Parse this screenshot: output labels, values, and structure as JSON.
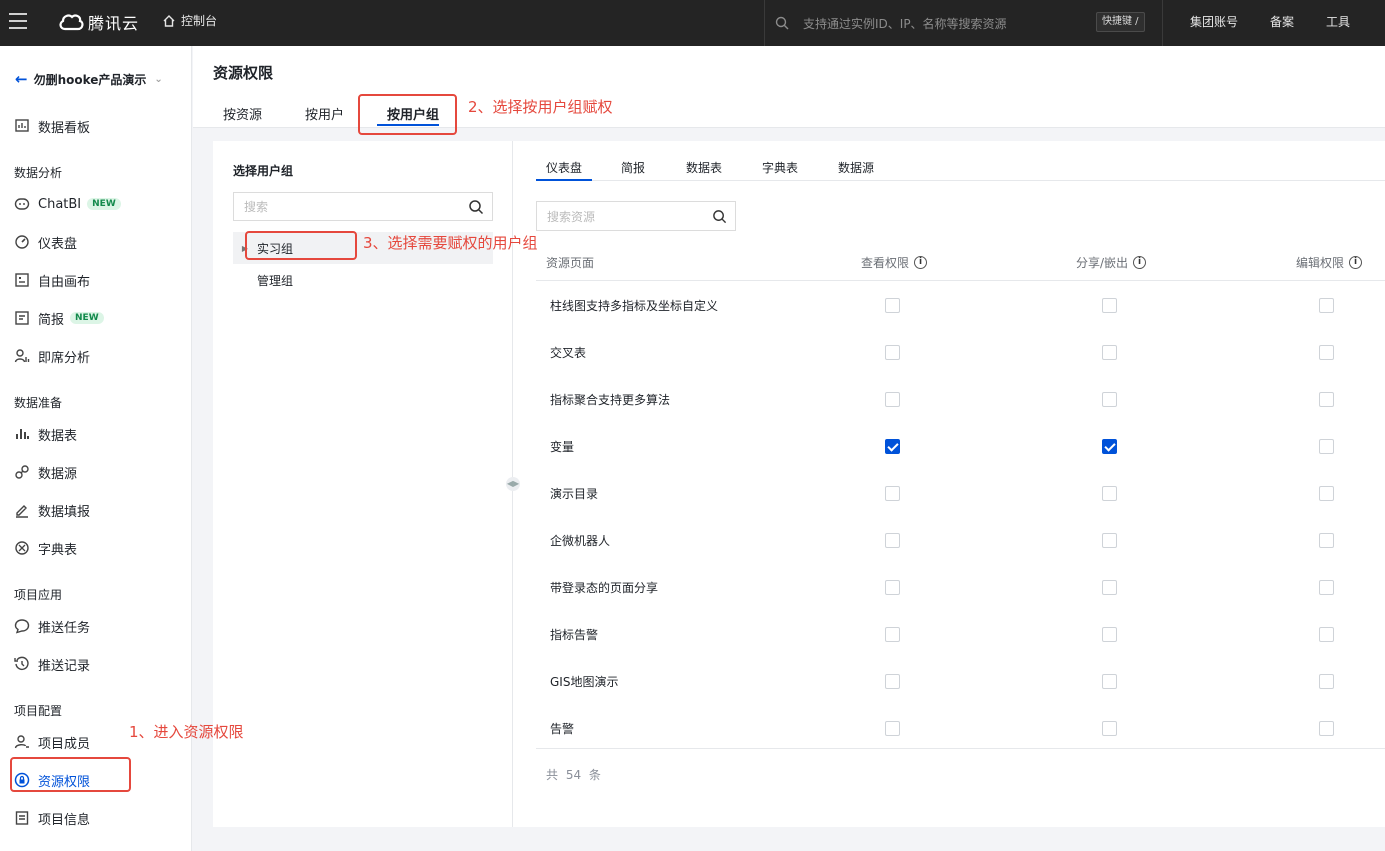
{
  "topbar": {
    "logo_text": "腾讯云",
    "console": "控制台",
    "search_placeholder": "支持通过实例ID、IP、名称等搜索资源",
    "hotkey": "快捷键 /",
    "links": [
      "集团账号",
      "备案",
      "工具"
    ]
  },
  "sidebar": {
    "project": "勿删hooke产品演示",
    "dashboard_board": "数据看板",
    "sections": {
      "analysis": "数据分析",
      "prepare": "数据准备",
      "app": "项目应用",
      "config": "项目配置"
    },
    "items": {
      "chatbi": "ChatBI",
      "dashboard": "仪表盘",
      "canvas": "自由画布",
      "brief": "简报",
      "adhoc": "即席分析",
      "table": "数据表",
      "source": "数据源",
      "fill": "数据填报",
      "dict": "字典表",
      "push_task": "推送任务",
      "push_log": "推送记录",
      "members": "项目成员",
      "permissions": "资源权限",
      "info": "项目信息"
    },
    "badge_new": "NEW"
  },
  "header": {
    "title": "资源权限",
    "tabs": [
      "按资源",
      "按用户",
      "按用户组"
    ]
  },
  "left_pane": {
    "title": "选择用户组",
    "search_placeholder": "搜索",
    "groups": [
      "实习组",
      "管理组"
    ]
  },
  "right_pane": {
    "tabs": [
      "仪表盘",
      "简报",
      "数据表",
      "字典表",
      "数据源"
    ],
    "search_placeholder": "搜索资源",
    "columns": [
      "资源页面",
      "查看权限",
      "分享/嵌出",
      "编辑权限"
    ],
    "rows": [
      {
        "name": "柱线图支持多指标及坐标自定义",
        "view": false,
        "share": false,
        "edit": false
      },
      {
        "name": "交叉表",
        "view": false,
        "share": false,
        "edit": false
      },
      {
        "name": "指标聚合支持更多算法",
        "view": false,
        "share": false,
        "edit": false
      },
      {
        "name": "变量",
        "view": true,
        "share": true,
        "edit": false
      },
      {
        "name": "演示目录",
        "view": false,
        "share": false,
        "edit": false
      },
      {
        "name": "企微机器人",
        "view": false,
        "share": false,
        "edit": false
      },
      {
        "name": "带登录态的页面分享",
        "view": false,
        "share": false,
        "edit": false
      },
      {
        "name": "指标告警",
        "view": false,
        "share": false,
        "edit": false
      },
      {
        "name": "GIS地图演示",
        "view": false,
        "share": false,
        "edit": false
      },
      {
        "name": "告警",
        "view": false,
        "share": false,
        "edit": false
      }
    ],
    "total": "共 54 条"
  },
  "annotations": {
    "step1": "1、进入资源权限",
    "step2": "2、选择按用户组赋权",
    "step3": "3、选择需要赋权的用户组"
  },
  "colors": {
    "accent": "#0052d9",
    "annotation": "#e5483d",
    "topbar": "#242424"
  }
}
